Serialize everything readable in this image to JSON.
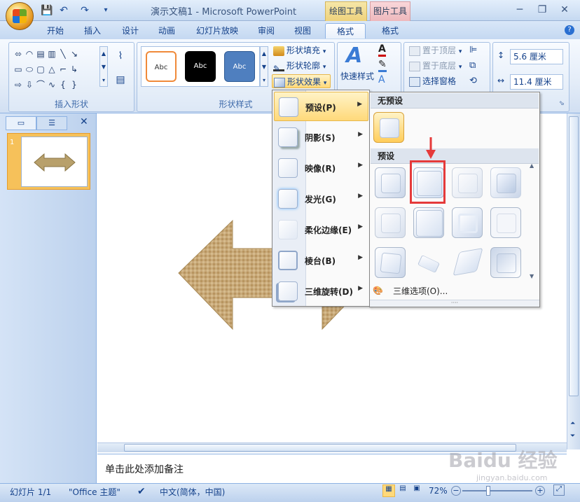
{
  "window": {
    "title": "演示文稿1 - Microsoft PowerPoint",
    "ctx_draw": "绘图工具",
    "ctx_pic": "图片工具",
    "minimize": "─",
    "restore": "❐",
    "close": "✕"
  },
  "tabs": [
    "开始",
    "插入",
    "设计",
    "动画",
    "幻灯片放映",
    "审阅",
    "视图",
    "格式",
    "格式"
  ],
  "groups": {
    "insert_shape": "插入形状",
    "shape_styles": "形状样式"
  },
  "style_presets": [
    "Abc",
    "Abc",
    "Abc"
  ],
  "shape_buttons": {
    "fill": "形状填充",
    "outline": "形状轮廓",
    "effect": "形状效果"
  },
  "quick_styles": "快速样式",
  "arrange": {
    "front": "置于顶层",
    "back": "置于底层",
    "pane": "选择窗格"
  },
  "size": {
    "height": "5.6 厘米",
    "width": "11.4 厘米"
  },
  "menu": {
    "items": [
      {
        "label": "预设(P)"
      },
      {
        "label": "阴影(S)"
      },
      {
        "label": "映像(R)"
      },
      {
        "label": "发光(G)"
      },
      {
        "label": "柔化边缘(E)"
      },
      {
        "label": "棱台(B)"
      },
      {
        "label": "三维旋转(D)"
      }
    ]
  },
  "submenu": {
    "no_preset_header": "无预设",
    "preset_header": "预设",
    "options": "三维选项(O)..."
  },
  "left_panel": {
    "slide_number": "1",
    "close": "✕"
  },
  "notes": {
    "placeholder": "单击此处添加备注"
  },
  "status": {
    "slide": "幻灯片 1/1",
    "theme": "\"Office 主题\"",
    "language": "中文(简体，中国)",
    "zoom": "72%"
  },
  "watermark": {
    "brand": "Baidu 经验",
    "url": "jingyan.baidu.com"
  }
}
